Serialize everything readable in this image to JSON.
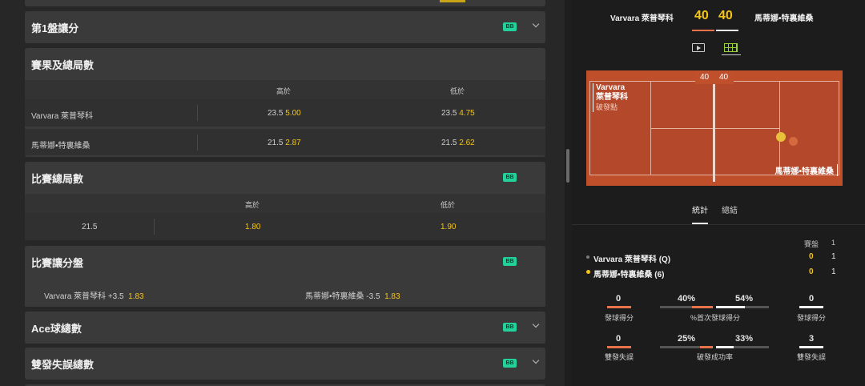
{
  "markets": {
    "set1_handicap": {
      "title": "第1盤讓分",
      "badge": "BB"
    },
    "result_total_games": {
      "title": "賽果及總局數",
      "badge": "BB",
      "columns": [
        "高於",
        "低於"
      ],
      "rows": [
        {
          "name": "Varvara 萊普琴科",
          "over_line": "23.5",
          "over_odds": "5.00",
          "under_line": "23.5",
          "under_odds": "4.75"
        },
        {
          "name": "馬蒂娜•特裏維桑",
          "over_line": "21.5",
          "over_odds": "2.87",
          "under_line": "21.5",
          "under_odds": "2.62"
        }
      ]
    },
    "match_total_games": {
      "title": "比賽總局數",
      "badge": "BB",
      "columns": [
        "高於",
        "低於"
      ],
      "line": "21.5",
      "over_odds": "1.80",
      "under_odds": "1.90"
    },
    "match_handicap": {
      "title": "比賽讓分盤",
      "badge": "BB",
      "p1": {
        "label": "Varvara 萊普琴科 +3.5",
        "odds": "1.83"
      },
      "p2": {
        "label": "馬蒂娜•特裏維桑 -3.5",
        "odds": "1.83"
      }
    },
    "total_aces": {
      "title": "Ace球總數",
      "badge": "BB"
    },
    "total_double_faults": {
      "title": "雙發失誤總數",
      "badge": "BB"
    }
  },
  "scoreboard": {
    "player1": "Varvara 萊普琴科",
    "player2": "馬蒂娜•特裏維桑",
    "score1": "40",
    "score2": "40"
  },
  "court": {
    "score1": "40",
    "score2": "40",
    "player1": "Varvara",
    "player1_line2": "萊普琴科",
    "player1_status": "破發點",
    "player2": "馬蒂娜•特裏維桑"
  },
  "tabs": {
    "stats": "統計",
    "summary": "總結"
  },
  "sets": {
    "header": "賽盤",
    "set_col": "1",
    "rows": [
      {
        "name": "Varvara 萊普琴科 (Q)",
        "game": "0",
        "set1": "1"
      },
      {
        "name": "馬蒂娜•特裏維桑 (6)",
        "game": "0",
        "set1": "1"
      }
    ]
  },
  "stats": {
    "aces": {
      "p1": "0",
      "p2": "0",
      "label": "發球得分"
    },
    "first_serve_pct": {
      "p1": "40%",
      "p2": "54%",
      "label": "%首次發球得分",
      "p1_value": 0.4,
      "p2_value": 0.54
    },
    "double_faults": {
      "p1": "0",
      "p2": "3",
      "label": "雙發失誤"
    },
    "break_points": {
      "p1": "25%",
      "p2": "33%",
      "label": "破發成功率",
      "p1_value": 0.25,
      "p2_value": 0.33
    }
  },
  "colors": {
    "accent": "#f5c518",
    "badge": "#23d29b",
    "court": "#bf4e2a",
    "p1": "#e8734a",
    "p2": "#f0f0f0"
  }
}
